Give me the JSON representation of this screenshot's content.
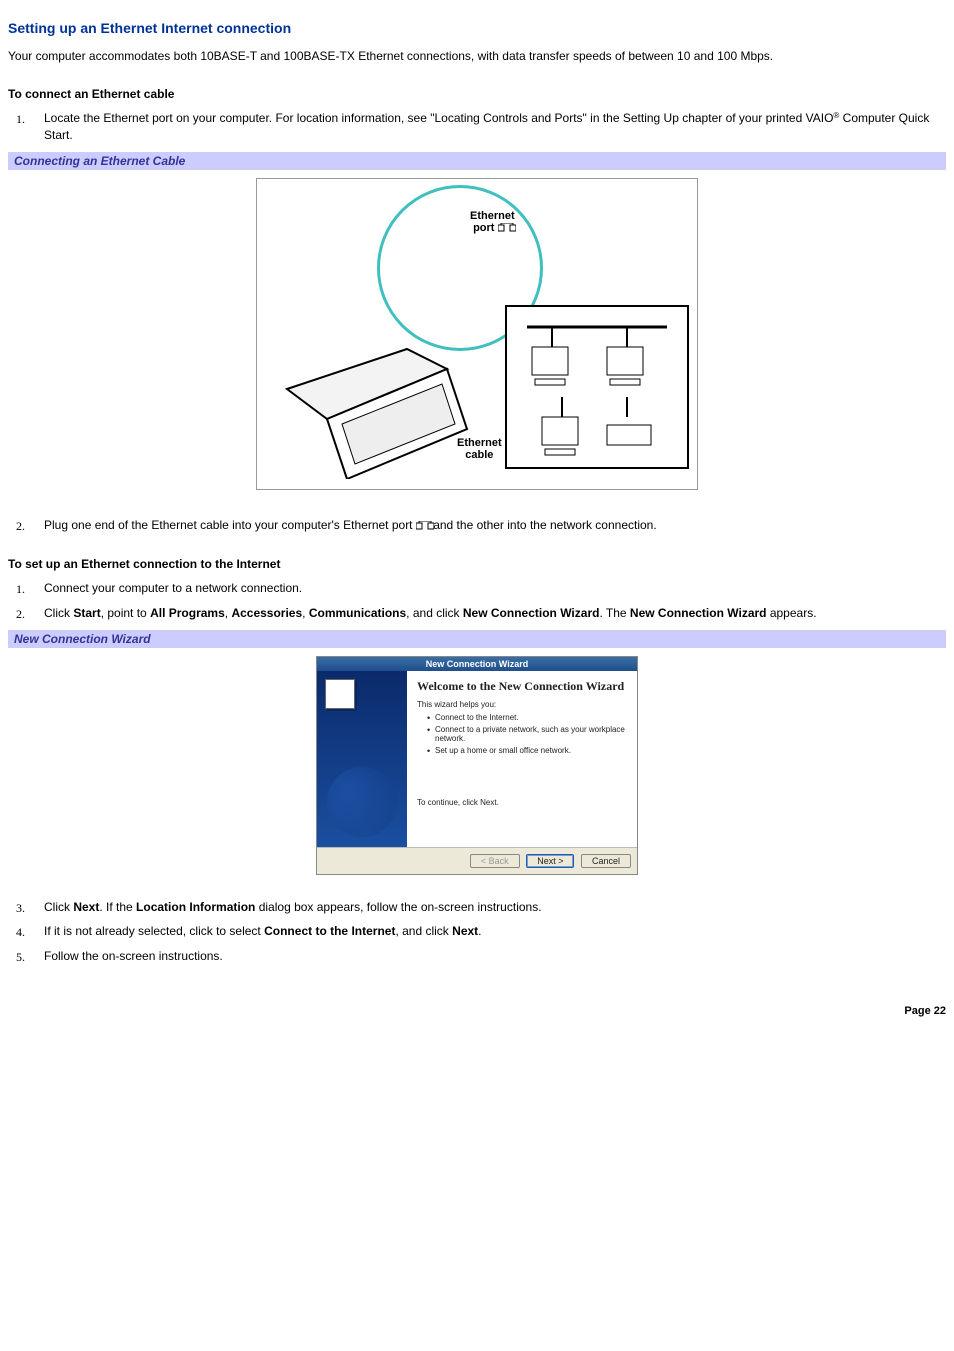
{
  "title": "Setting up an Ethernet Internet connection",
  "intro": "Your computer accommodates both 10BASE-T and 100BASE-TX Ethernet connections, with data transfer speeds of between 10 and 100 Mbps.",
  "sectionA": {
    "heading": "To connect an Ethernet cable",
    "step1_a": "Locate the Ethernet port on your computer. For location information, see \"Locating Controls and Ports\" in the Setting Up chapter of your printed VAIO",
    "step1_reg": "®",
    "step1_b": " Computer Quick Start.",
    "step2_a": "Plug one end of the Ethernet cable into your computer's Ethernet port ",
    "step2_b": " and the other into the network connection."
  },
  "band1": "Connecting an Ethernet Cable",
  "fig1": {
    "zoom_label_a": "Ethernet",
    "zoom_label_b": "port",
    "cable_label_a": "Ethernet",
    "cable_label_b": "cable"
  },
  "sectionB": {
    "heading": "To set up an Ethernet connection to the Internet",
    "step1": "Connect your computer to a network connection.",
    "step2_a": "Click ",
    "step2_start": "Start",
    "step2_b": ", point to ",
    "step2_allprograms": "All Programs",
    "step2_c": ", ",
    "step2_acc": "Accessories",
    "step2_d": ", ",
    "step2_comm": "Communications",
    "step2_e": ", and click ",
    "step2_ncw": "New Connection Wizard",
    "step2_f": ". The ",
    "step2_ncw2": "New Connection Wizard",
    "step2_g": " appears.",
    "step3_a": "Click ",
    "step3_next": "Next",
    "step3_b": ". If the ",
    "step3_loc": "Location Information",
    "step3_c": " dialog box appears, follow the on-screen instructions.",
    "step4_a": "If it is not already selected, click to select ",
    "step4_cti": "Connect to the Internet",
    "step4_b": ", and click ",
    "step4_next": "Next",
    "step4_c": ".",
    "step5": "Follow the on-screen instructions."
  },
  "band2": "New Connection Wizard",
  "wizard": {
    "titlebar": "New Connection Wizard",
    "welcome": "Welcome to the New Connection Wizard",
    "helps": "This wizard helps you:",
    "b1": "Connect to the Internet.",
    "b2": "Connect to a private network, such as your workplace network.",
    "b3": "Set up a home or small office network.",
    "continue": "To continue, click Next.",
    "back": "< Back",
    "next": "Next >",
    "cancel": "Cancel"
  },
  "page_number": "Page 22"
}
